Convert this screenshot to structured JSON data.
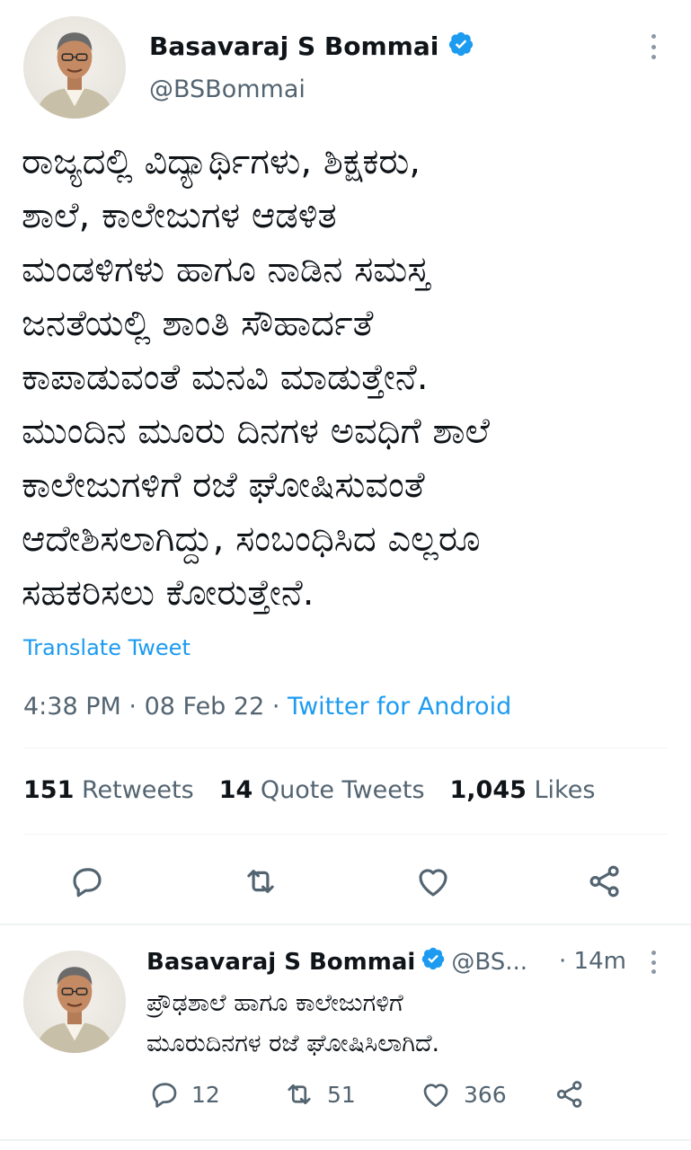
{
  "main_tweet": {
    "author_name": "Basavaraj S Bommai",
    "handle": "@BSBommai",
    "text_lines": [
      "ರಾಜ್ಯದಲ್ಲಿ ವಿದ್ಯಾರ್ಥಿಗಳು, ಶಿಕ್ಷಕರು,",
      "ಶಾಲೆ, ಕಾಲೇಜುಗಳ ಆಡಳಿತ",
      "ಮಂಡಳಿಗಳು ಹಾಗೂ ನಾಡಿನ ಸಮಸ್ತ",
      "ಜನತೆಯಲ್ಲಿ ಶಾಂತಿ ಸೌಹಾರ್ದತೆ",
      "ಕಾಪಾಡುವಂತೆ ಮನವಿ ಮಾಡುತ್ತೇನೆ.",
      "ಮುಂದಿನ ಮೂರು ದಿನಗಳ ಅವಧಿಗೆ ಶಾಲೆ",
      "ಕಾಲೇಜುಗಳಿಗೆ ರಜೆ ಘೋಷಿಸುವಂತೆ",
      "ಆದೇಶಿಸಲಾಗಿದ್ದು, ಸಂಬಂಧಿಸಿದ ಎಲ್ಲರೂ",
      "ಸಹಕರಿಸಲು ಕೋರುತ್ತೇನೆ."
    ],
    "translate_label": "Translate Tweet",
    "time": "4:38 PM",
    "date": "08 Feb 22",
    "separator": "·",
    "source": "Twitter for Android",
    "retweets_count": "151",
    "retweets_label": "Retweets",
    "quotes_count": "14",
    "quotes_label": "Quote Tweets",
    "likes_count": "1,045",
    "likes_label": "Likes"
  },
  "reply_tweet": {
    "author_name": "Basavaraj S Bommai",
    "handle": "@BS...",
    "time_ago": "· 14m",
    "text_lines": [
      "ಪ್ರೌಢಶಾಲೆ ಹಾಗೂ ಕಾಲೇಜುಗಳಿಗೆ",
      "ಮೂರುದಿನಗಳ ರಜೆ ಘೋಷಿಸಿಲಾಗಿದೆ."
    ],
    "reply_count": "12",
    "retweet_count": "51",
    "like_count": "366"
  },
  "colors": {
    "accent": "#1d9bf0",
    "text": "#0f1419",
    "muted": "#536471",
    "divider": "#eff3f4"
  },
  "icons": [
    "verified-badge-icon",
    "more-options-icon",
    "reply-icon",
    "retweet-icon",
    "like-icon",
    "share-icon"
  ]
}
